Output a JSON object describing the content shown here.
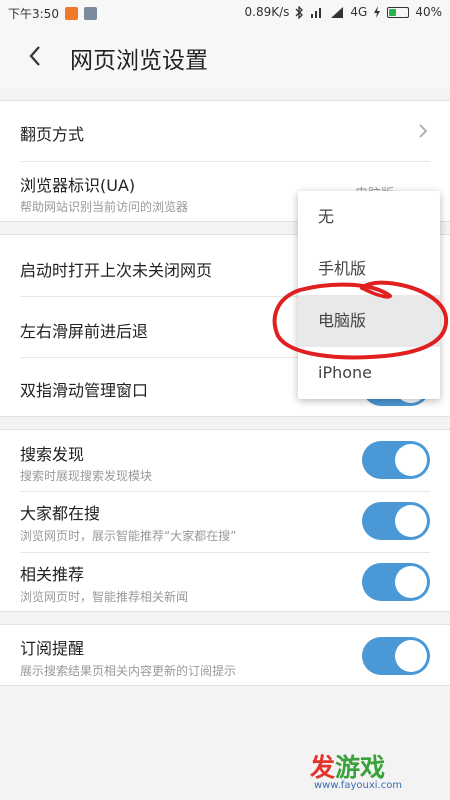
{
  "status_bar": {
    "time": "下午3:50",
    "net_speed": "0.89K/s",
    "network": "4G",
    "battery": "40%",
    "battery_level": 0.4
  },
  "header": {
    "title": "网页浏览设置"
  },
  "settings": {
    "page_turn": {
      "label": "翻页方式"
    },
    "ua": {
      "label": "浏览器标识(UA)",
      "sub": "帮助网站识别当前访问的浏览器",
      "value": "电脑版"
    },
    "restore": {
      "label": "启动时打开上次未关闭网页"
    },
    "swipe": {
      "label": "左右滑屏前进后退"
    },
    "two_finger": {
      "label": "双指滑动管理窗口"
    },
    "search_discover": {
      "label": "搜索发现",
      "sub": "搜索时展现搜索发现模块"
    },
    "everyone_search": {
      "label": "大家都在搜",
      "sub": "浏览网页时，展示智能推荐“大家都在搜”"
    },
    "related": {
      "label": "相关推荐",
      "sub": "浏览网页时，智能推荐相关新闻"
    },
    "subscribe": {
      "label": "订阅提醒",
      "sub": "展示搜索结果页相关内容更新的订阅提示"
    }
  },
  "dropdown": {
    "options": [
      "无",
      "手机版",
      "电脑版",
      "iPhone"
    ],
    "selected": "电脑版"
  },
  "watermark": {
    "logo_a": "发",
    "logo_b": "游戏",
    "url": "www.fayouxi.com"
  },
  "colors": {
    "accent": "#4a98d6",
    "annotation": "#e02020"
  }
}
